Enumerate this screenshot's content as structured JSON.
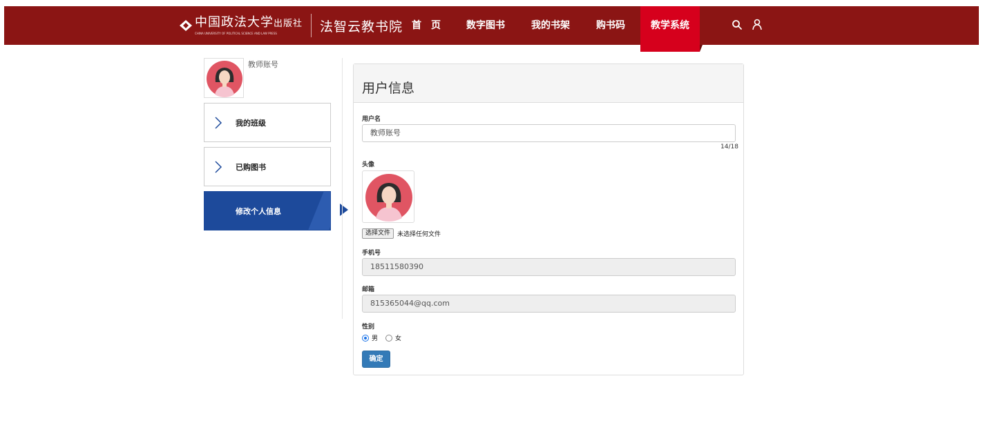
{
  "header": {
    "logo_cn": "中国政法大学",
    "logo_press": "出版社",
    "logo_en": "CHINA UNIVERSITY OF POLITICAL SCIENCE AND LAW PRESS",
    "site_name": "法智云教书院",
    "nav": [
      {
        "label": "首　页"
      },
      {
        "label": "数字图书"
      },
      {
        "label": "我的书架"
      },
      {
        "label": "购书码"
      },
      {
        "label": "教学系统",
        "active": true
      }
    ],
    "brand_color": "#8b1514",
    "active_color": "#d6001c",
    "icons": [
      "search-icon",
      "user-icon"
    ]
  },
  "sidebar": {
    "account_name": "教师账号",
    "items": [
      {
        "label": "我的班级",
        "icon": "chevron-right-icon"
      },
      {
        "label": "已购图书",
        "icon": "chevron-right-icon"
      },
      {
        "label": "修改个人信息",
        "active": true
      }
    ],
    "active_color": "#1d4a9b"
  },
  "panel": {
    "title": "用户信息",
    "username_label": "用户名",
    "username_value": "教师账号",
    "username_counter": "14/18",
    "avatar_label": "头像",
    "file_button": "选择文件",
    "file_status": "未选择任何文件",
    "phone_label": "手机号",
    "phone_value": "18511580390",
    "email_label": "邮箱",
    "email_value": "815365044@qq.com",
    "gender_label": "性别",
    "gender_options": [
      {
        "label": "男",
        "checked": true
      },
      {
        "label": "女",
        "checked": false
      }
    ],
    "submit_label": "确定"
  }
}
